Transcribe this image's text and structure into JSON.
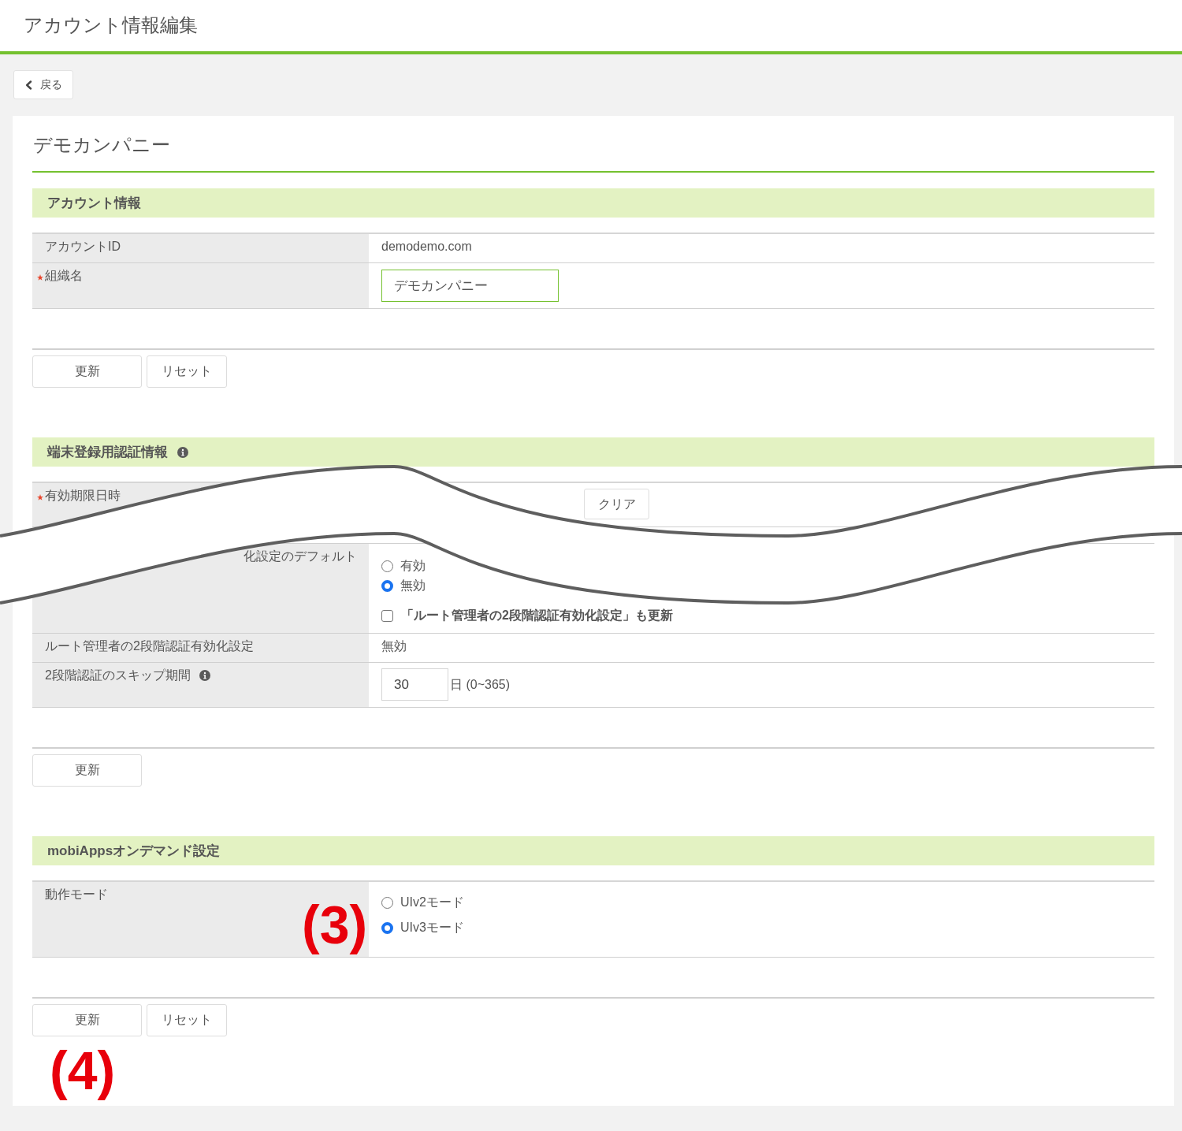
{
  "header": {
    "title": "アカウント情報編集"
  },
  "back_button": {
    "label": "戻る"
  },
  "card": {
    "title": "デモカンパニー",
    "sections": [
      {
        "title": "アカウント情報",
        "info": false,
        "rows": [
          {
            "kind": "text",
            "label": "アカウントID",
            "required": false,
            "info": false,
            "label_clipped": false,
            "value": "demodemo.com"
          },
          {
            "kind": "input",
            "label": "組織名",
            "required": true,
            "info": false,
            "label_clipped": false,
            "value": "デモカンパニー",
            "focused": true
          }
        ],
        "buttons": [
          {
            "label": "更新"
          },
          {
            "label": "リセット"
          }
        ]
      },
      {
        "title": "端末登録用認証情報",
        "info": true,
        "rows": [
          {
            "kind": "datetime",
            "label": "有効期限日時",
            "required": true,
            "info": false,
            "label_clipped": false,
            "button": "クリア"
          },
          {
            "kind": "break"
          },
          {
            "kind": "options",
            "label": "化設定のデフォルト",
            "required": false,
            "info": false,
            "label_clipped": true,
            "options": [
              {
                "label": "有効",
                "selected": false
              },
              {
                "label": "無効",
                "selected": true
              }
            ],
            "checkbox": {
              "label": "「ルート管理者の2段階認証有効化設定」も更新",
              "checked": false
            }
          },
          {
            "kind": "text",
            "label": "ルート管理者の2段階認証有効化設定",
            "required": false,
            "info": false,
            "label_clipped": false,
            "value": "無効"
          },
          {
            "kind": "number",
            "label": "2段階認証のスキップ期間",
            "required": false,
            "info": true,
            "label_clipped": false,
            "value": "30",
            "unit": "日 (0~365)",
            "focused": false
          }
        ],
        "buttons": [
          {
            "label": "更新"
          }
        ]
      },
      {
        "title": "mobiAppsオンデマンド設定",
        "info": false,
        "rows": [
          {
            "kind": "options",
            "label": "動作モード",
            "required": false,
            "info": false,
            "label_clipped": false,
            "options": [
              {
                "label": "UIv2モード",
                "selected": false
              },
              {
                "label": "UIv3モード",
                "selected": true
              }
            ],
            "annotation": "(3)"
          }
        ],
        "buttons": [
          {
            "label": "更新"
          },
          {
            "label": "リセット"
          }
        ],
        "annotation": "(4)"
      }
    ]
  }
}
